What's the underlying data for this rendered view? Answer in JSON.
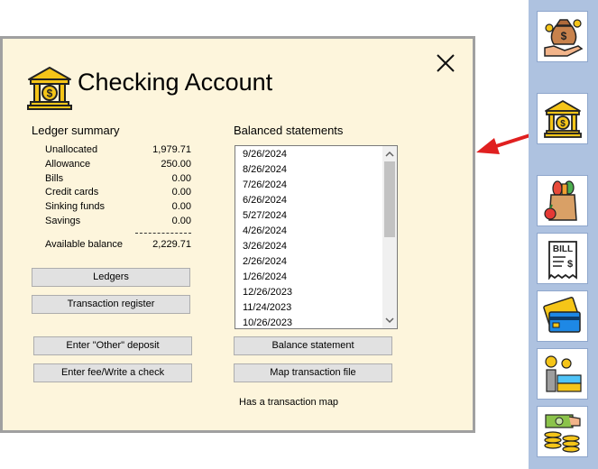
{
  "dialog": {
    "title": "Checking Account",
    "icon": "bank-icon",
    "close_icon": "close-icon"
  },
  "ledger_summary": {
    "heading": "Ledger summary",
    "rows": [
      {
        "label": "Unallocated",
        "value": "1,979.71"
      },
      {
        "label": "Allowance",
        "value": "250.00"
      },
      {
        "label": "Bills",
        "value": "0.00"
      },
      {
        "label": "Credit cards",
        "value": "0.00"
      },
      {
        "label": "Sinking funds",
        "value": "0.00"
      },
      {
        "label": "Savings",
        "value": "0.00"
      }
    ],
    "available": {
      "label": "Available balance",
      "value": "2,229.71"
    }
  },
  "buttons": {
    "ledgers": "Ledgers",
    "transaction_register": "Transaction register",
    "other_deposit": "Enter \"Other\" deposit",
    "fee_check": "Enter fee/Write a check",
    "balance_statement": "Balance statement",
    "map_transaction_file": "Map transaction file"
  },
  "balanced_statements": {
    "heading": "Balanced statements",
    "items": [
      "9/26/2024",
      "8/26/2024",
      "7/26/2024",
      "6/26/2024",
      "5/27/2024",
      "4/26/2024",
      "3/26/2024",
      "2/26/2024",
      "1/26/2024",
      "12/26/2023",
      "11/24/2023",
      "10/26/2023"
    ]
  },
  "status_note": "Has a transaction map",
  "toolbar": {
    "items": [
      "money-bag-hand-icon",
      "bank-icon",
      "groceries-icon",
      "bill-icon",
      "credit-card-icon",
      "savings-icon",
      "cash-coins-icon"
    ]
  },
  "colors": {
    "dialog_bg": "#fdf5dc",
    "toolbar_bg": "#aec2e0",
    "arrow": "#e02020",
    "bank_gold": "#f5c518"
  }
}
